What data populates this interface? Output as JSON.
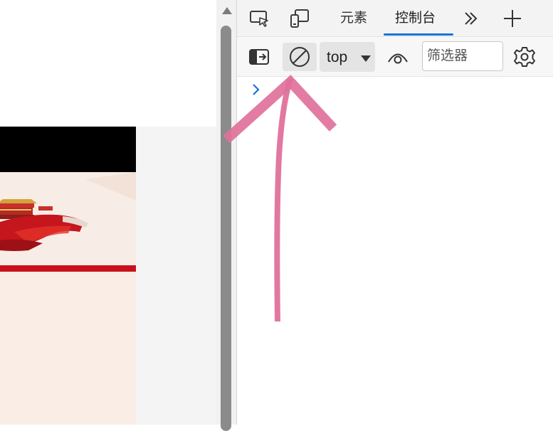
{
  "devtools": {
    "tabs": [
      {
        "label": "元素",
        "active": false
      },
      {
        "label": "控制台",
        "active": true
      }
    ],
    "icons": {
      "inspect": "inspect-element-icon",
      "device": "device-emulation-icon",
      "more_tabs": "double-chevron-right-icon",
      "add_tab": "plus-icon"
    },
    "toolbar": {
      "sidebar_icon": "sidebar-toggle-icon",
      "clear_icon": "clear-console-icon",
      "context_value": "top",
      "eye_icon": "live-expression-eye-icon",
      "filter_placeholder": "筛选器",
      "settings_icon": "gear-icon"
    },
    "console": {
      "prompt_icon": "chevron-right-icon"
    }
  },
  "colors": {
    "accent": "#1a73d9",
    "annotation_arrow": "#e0719b",
    "banner_red": "#c8111b"
  }
}
